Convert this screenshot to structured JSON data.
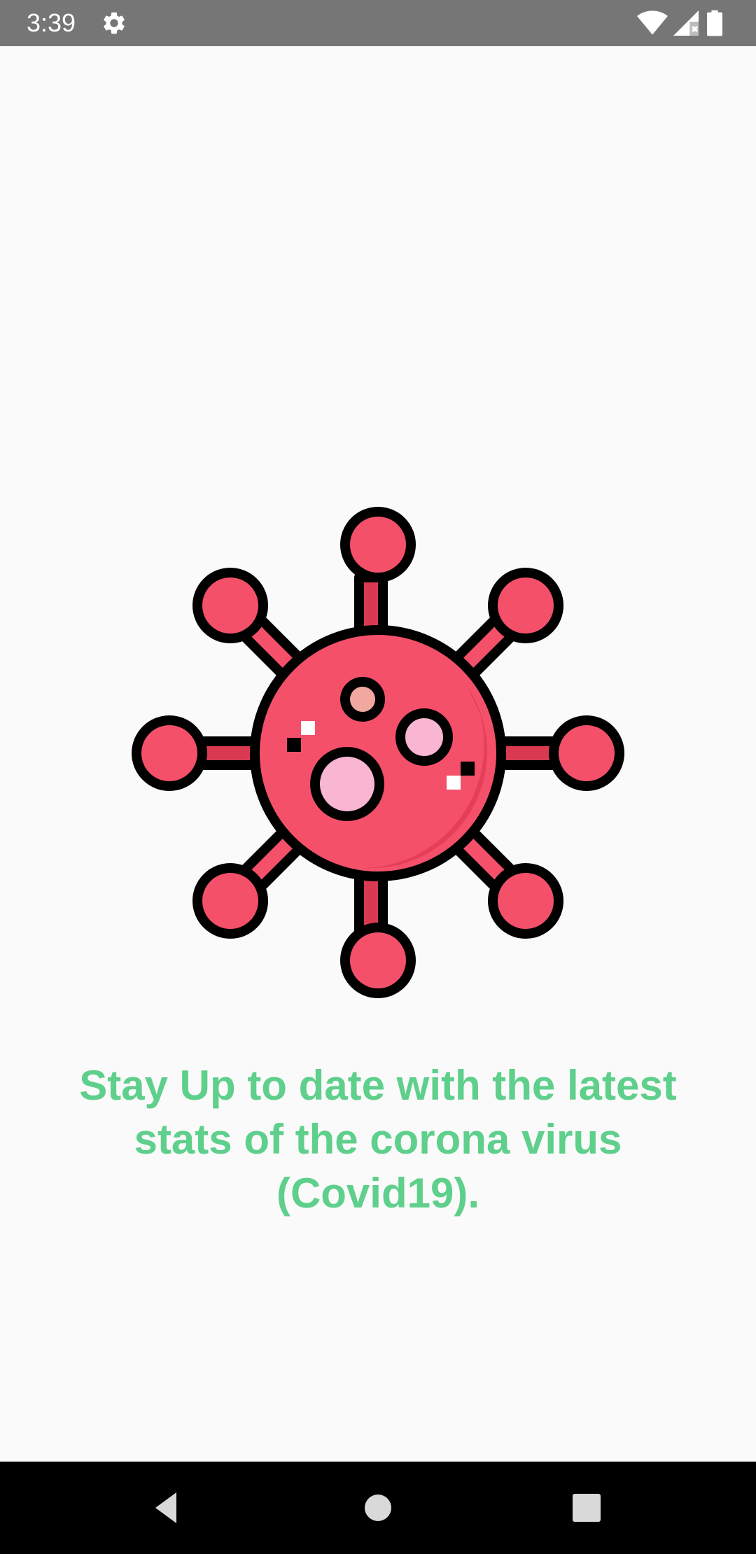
{
  "status_bar": {
    "time": "3:39",
    "background_color": "#767676",
    "icons": [
      "settings-gear-icon",
      "wifi-icon",
      "cell-signal-icon",
      "battery-icon"
    ]
  },
  "main": {
    "illustration": "coronavirus-icon",
    "tagline": "Stay Up to date with the latest stats of the corona virus (Covid19).",
    "tagline_color": "#5fcf8c",
    "virus_color": "#f4506a",
    "spot_color": "#f8b6d2"
  },
  "nav_bar": {
    "buttons": [
      "back-button",
      "home-button",
      "recents-button"
    ]
  }
}
